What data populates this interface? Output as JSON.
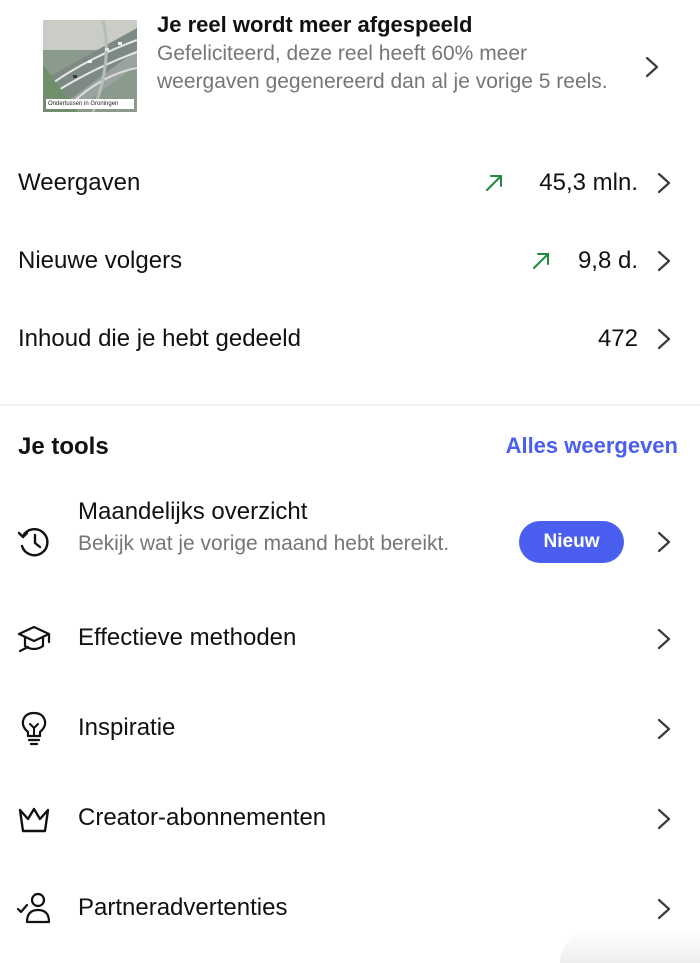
{
  "reel_notice": {
    "title": "Je reel wordt meer afgespeeld",
    "description": "Gefeliciteerd, deze reel heeft 60% meer weergaven gegenereerd dan al je vorige 5 reels.",
    "thumbnail_caption": "Ondertussen in Groningen"
  },
  "stats": [
    {
      "label": "Weergaven",
      "value": "45,3 mln.",
      "trend": "up"
    },
    {
      "label": "Nieuwe volgers",
      "value": "9,8 d.",
      "trend": "up"
    },
    {
      "label": "Inhoud die je hebt gedeeld",
      "value": "472"
    }
  ],
  "tools": {
    "title": "Je tools",
    "see_all": "Alles weergeven",
    "items": [
      {
        "label": "Maandelijks overzicht",
        "subtitle": "Bekijk wat je vorige maand hebt bereikt.",
        "badge": "Nieuw",
        "icon": "history-clock-icon"
      },
      {
        "label": "Effectieve methoden",
        "icon": "graduation-cap-icon"
      },
      {
        "label": "Inspiratie",
        "icon": "lightbulb-icon"
      },
      {
        "label": "Creator-abonnementen",
        "icon": "crown-icon"
      },
      {
        "label": "Partneradvertenties",
        "icon": "partner-check-icon"
      }
    ]
  },
  "colors": {
    "accent": "#4a5ff0",
    "trend_up": "#1e8a3e",
    "secondary_text": "#767676",
    "chevron": "#3a3a3a"
  }
}
